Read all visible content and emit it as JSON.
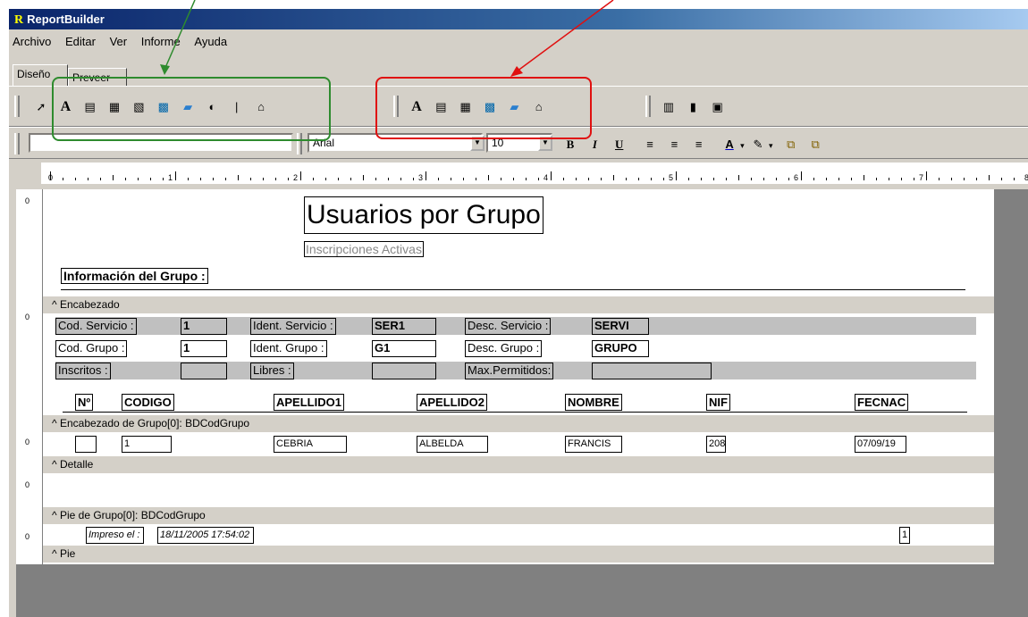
{
  "app": {
    "title": "ReportBuilder",
    "logo_letter": "R"
  },
  "menu": [
    "Archivo",
    "Editar",
    "Ver",
    "Informe",
    "Ayuda"
  ],
  "tabs": [
    "Diseño",
    "Preveer"
  ],
  "font": {
    "name": "Arial",
    "size": "10"
  },
  "ruler": [
    "0",
    "1",
    "2",
    "3",
    "4",
    "5",
    "6",
    "7",
    "8"
  ],
  "report": {
    "title": "Usuarios por Grupo",
    "subtitle": "Inscripciones Activas",
    "group_info": "Información del Grupo :",
    "bands": {
      "header": "Encabezado",
      "group_header": "Encabezado de Grupo[0]: BDCodGrupo",
      "detail": "Detalle",
      "group_footer": "Pie de Grupo[0]: BDCodGrupo",
      "footer": "Pie"
    },
    "fields": {
      "cod_servicio": "Cod. Servicio :",
      "cod_servicio_val": "1",
      "ident_servicio": "Ident. Servicio :",
      "ident_servicio_val": "SER1",
      "desc_servicio": "Desc. Servicio :",
      "desc_servicio_val": "SERVI",
      "cod_grupo": "Cod. Grupo :",
      "cod_grupo_val": "1",
      "ident_grupo": "Ident. Grupo :",
      "ident_grupo_val": "G1",
      "desc_grupo": "Desc. Grupo :",
      "desc_grupo_val": "GRUPO",
      "inscritos": "Inscritos :",
      "libres": "Libres :",
      "max_permitidos": "Max.Permitidos:"
    },
    "columns": [
      "Nº",
      "CODIGO",
      "APELLIDO1",
      "APELLIDO2",
      "NOMBRE",
      "NIF",
      "FECNAC"
    ],
    "row": [
      "",
      "1",
      "CEBRIA",
      "ALBELDA",
      "FRANCIS",
      "208",
      "07/09/19"
    ],
    "printed_label": "Impreso el :",
    "printed_value": "18/11/2005 17:54:02",
    "page_num": "1"
  },
  "colors": {
    "green_annotation": "#2e8b2e",
    "red_annotation": "#e01010"
  }
}
